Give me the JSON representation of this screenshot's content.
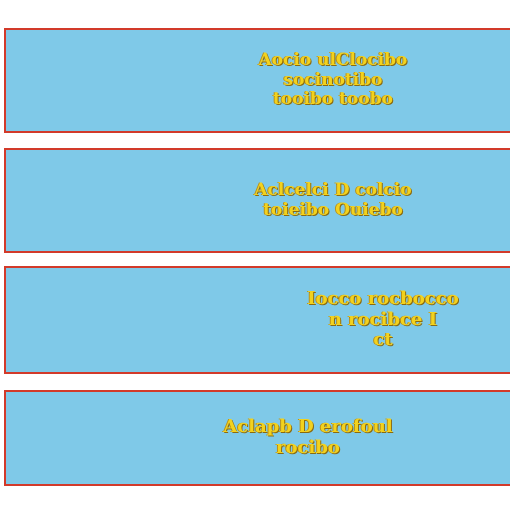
{
  "panels": [
    {
      "lines": [
        "Aocio ulClocibo",
        "socinotibo",
        "tooibo toobo"
      ]
    },
    {
      "lines": [
        "Aclcelci D colcio",
        "toieibo Ouiebo"
      ]
    },
    {
      "lines": [
        "Iocco rocbocco",
        "n rocibce I",
        "ct"
      ]
    },
    {
      "lines": [
        "Aclapb D erofoul",
        "rocibo"
      ]
    }
  ],
  "colors": {
    "panel_bg": "#7fc9e8",
    "panel_border": "#d23a2a",
    "text": "#f2d21e"
  }
}
